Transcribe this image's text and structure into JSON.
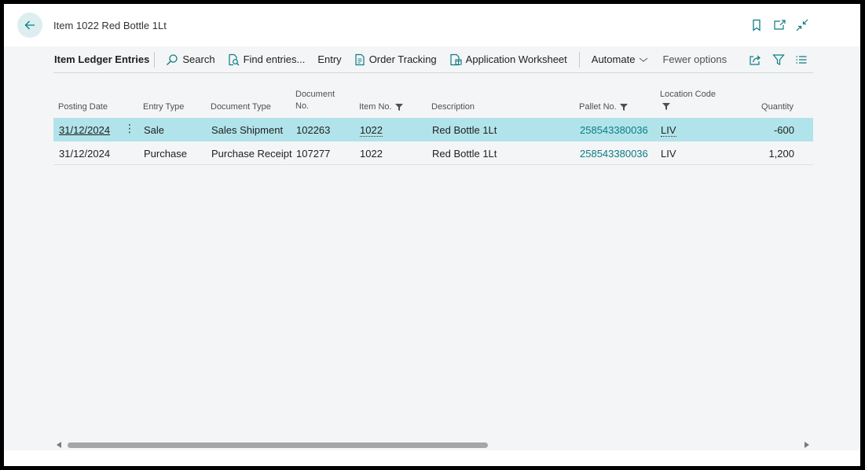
{
  "header": {
    "title": "Item 1022 Red Bottle 1Lt",
    "icons": [
      "back-arrow-icon",
      "bookmark-icon",
      "open-new-window-icon",
      "collapse-icon"
    ]
  },
  "actionbar": {
    "page_name": "Item Ledger Entries",
    "search": "Search",
    "find_entries": "Find entries...",
    "entry": "Entry",
    "order_tracking": "Order Tracking",
    "application_worksheet": "Application Worksheet",
    "automate": "Automate",
    "fewer_options": "Fewer options",
    "right_icons": [
      "share-icon",
      "filter-icon",
      "list-view-icon"
    ]
  },
  "columns": {
    "posting_date": "Posting Date",
    "entry_type": "Entry Type",
    "document_type": "Document Type",
    "document_no_line1": "Document",
    "document_no_line2": "No.",
    "item_no": "Item No.",
    "description": "Description",
    "pallet_no": "Pallet No.",
    "location_code": "Location Code",
    "quantity": "Quantity"
  },
  "rows": [
    {
      "posting_date": "31/12/2024",
      "entry_type": "Sale",
      "document_type": "Sales Shipment",
      "document_no": "102263",
      "item_no": "1022",
      "description": "Red Bottle 1Lt",
      "pallet_no": "258543380036",
      "location_code": "LIV",
      "quantity": "-600"
    },
    {
      "posting_date": "31/12/2024",
      "entry_type": "Purchase",
      "document_type": "Purchase Receipt",
      "document_no": "107277",
      "item_no": "1022",
      "description": "Red Bottle 1Lt",
      "pallet_no": "258543380036",
      "location_code": "LIV",
      "quantity": "1,200"
    }
  ],
  "colors": {
    "accent": "#0c7c84",
    "selected_row": "#b1e4ea",
    "content_bg": "#f4f5f6"
  }
}
